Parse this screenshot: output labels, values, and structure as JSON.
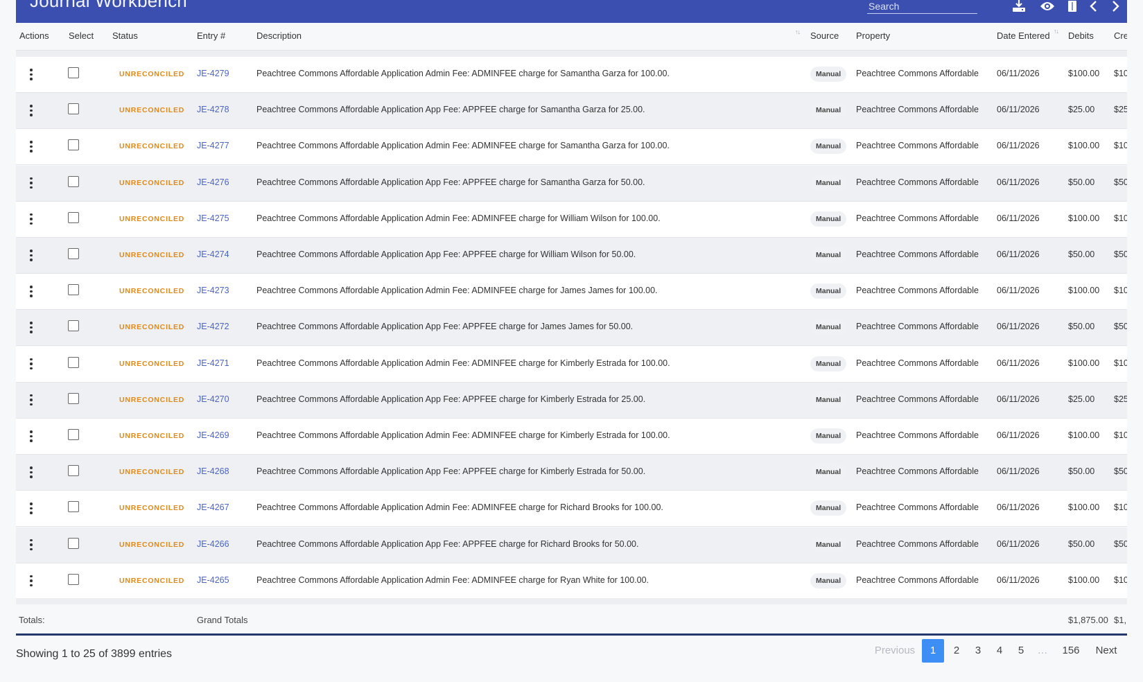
{
  "app": {
    "title": "Journal Workbench",
    "search_placeholder": "Search"
  },
  "toolbar": {
    "icons": [
      "download-icon",
      "eye-icon",
      "columns-icon",
      "chevron-left-icon",
      "chevron-right-icon"
    ]
  },
  "table": {
    "columns": {
      "actions": "Actions",
      "select": "Select",
      "status": "Status",
      "entry": "Entry #",
      "description": "Description",
      "source": "Source",
      "property": "Property",
      "date_entered": "Date Entered",
      "debits": "Debits",
      "credits": "Cre"
    },
    "rows": [
      {
        "status": "UNRECONCILED",
        "entry": "JE-4279",
        "description": "Peachtree Commons Affordable Application Admin Fee: ADMINFEE charge for Samantha Garza for 100.00.",
        "source": "Manual",
        "property": "Peachtree Commons Affordable",
        "date": "06/11/2026",
        "debit": "$100.00",
        "credit": "$10"
      },
      {
        "status": "UNRECONCILED",
        "entry": "JE-4278",
        "description": "Peachtree Commons Affordable Application App Fee: APPFEE charge for Samantha Garza for 25.00.",
        "source": "Manual",
        "property": "Peachtree Commons Affordable",
        "date": "06/11/2026",
        "debit": "$25.00",
        "credit": "$25"
      },
      {
        "status": "UNRECONCILED",
        "entry": "JE-4277",
        "description": "Peachtree Commons Affordable Application Admin Fee: ADMINFEE charge for Samantha Garza for 100.00.",
        "source": "Manual",
        "property": "Peachtree Commons Affordable",
        "date": "06/11/2026",
        "debit": "$100.00",
        "credit": "$10"
      },
      {
        "status": "UNRECONCILED",
        "entry": "JE-4276",
        "description": "Peachtree Commons Affordable Application App Fee: APPFEE charge for Samantha Garza for 50.00.",
        "source": "Manual",
        "property": "Peachtree Commons Affordable",
        "date": "06/11/2026",
        "debit": "$50.00",
        "credit": "$50"
      },
      {
        "status": "UNRECONCILED",
        "entry": "JE-4275",
        "description": "Peachtree Commons Affordable Application Admin Fee: ADMINFEE charge for William Wilson for 100.00.",
        "source": "Manual",
        "property": "Peachtree Commons Affordable",
        "date": "06/11/2026",
        "debit": "$100.00",
        "credit": "$10"
      },
      {
        "status": "UNRECONCILED",
        "entry": "JE-4274",
        "description": "Peachtree Commons Affordable Application App Fee: APPFEE charge for William Wilson for 50.00.",
        "source": "Manual",
        "property": "Peachtree Commons Affordable",
        "date": "06/11/2026",
        "debit": "$50.00",
        "credit": "$50"
      },
      {
        "status": "UNRECONCILED",
        "entry": "JE-4273",
        "description": "Peachtree Commons Affordable Application Admin Fee: ADMINFEE charge for James James for 100.00.",
        "source": "Manual",
        "property": "Peachtree Commons Affordable",
        "date": "06/11/2026",
        "debit": "$100.00",
        "credit": "$10"
      },
      {
        "status": "UNRECONCILED",
        "entry": "JE-4272",
        "description": "Peachtree Commons Affordable Application App Fee: APPFEE charge for James James for 50.00.",
        "source": "Manual",
        "property": "Peachtree Commons Affordable",
        "date": "06/11/2026",
        "debit": "$50.00",
        "credit": "$50"
      },
      {
        "status": "UNRECONCILED",
        "entry": "JE-4271",
        "description": "Peachtree Commons Affordable Application Admin Fee: ADMINFEE charge for Kimberly Estrada for 100.00.",
        "source": "Manual",
        "property": "Peachtree Commons Affordable",
        "date": "06/11/2026",
        "debit": "$100.00",
        "credit": "$10"
      },
      {
        "status": "UNRECONCILED",
        "entry": "JE-4270",
        "description": "Peachtree Commons Affordable Application App Fee: APPFEE charge for Kimberly Estrada for 25.00.",
        "source": "Manual",
        "property": "Peachtree Commons Affordable",
        "date": "06/11/2026",
        "debit": "$25.00",
        "credit": "$25"
      },
      {
        "status": "UNRECONCILED",
        "entry": "JE-4269",
        "description": "Peachtree Commons Affordable Application Admin Fee: ADMINFEE charge for Kimberly Estrada for 100.00.",
        "source": "Manual",
        "property": "Peachtree Commons Affordable",
        "date": "06/11/2026",
        "debit": "$100.00",
        "credit": "$10"
      },
      {
        "status": "UNRECONCILED",
        "entry": "JE-4268",
        "description": "Peachtree Commons Affordable Application App Fee: APPFEE charge for Kimberly Estrada for 50.00.",
        "source": "Manual",
        "property": "Peachtree Commons Affordable",
        "date": "06/11/2026",
        "debit": "$50.00",
        "credit": "$50"
      },
      {
        "status": "UNRECONCILED",
        "entry": "JE-4267",
        "description": "Peachtree Commons Affordable Application Admin Fee: ADMINFEE charge for Richard Brooks for 100.00.",
        "source": "Manual",
        "property": "Peachtree Commons Affordable",
        "date": "06/11/2026",
        "debit": "$100.00",
        "credit": "$10"
      },
      {
        "status": "UNRECONCILED",
        "entry": "JE-4266",
        "description": "Peachtree Commons Affordable Application App Fee: APPFEE charge for Richard Brooks for 50.00.",
        "source": "Manual",
        "property": "Peachtree Commons Affordable",
        "date": "06/11/2026",
        "debit": "$50.00",
        "credit": "$50"
      },
      {
        "status": "UNRECONCILED",
        "entry": "JE-4265",
        "description": "Peachtree Commons Affordable Application Admin Fee: ADMINFEE charge for Ryan White for 100.00.",
        "source": "Manual",
        "property": "Peachtree Commons Affordable",
        "date": "06/11/2026",
        "debit": "$100.00",
        "credit": "$10"
      }
    ],
    "totals": {
      "label": "Totals:",
      "grand_label": "Grand Totals",
      "debits": "$1,875.00",
      "credits": "$1,"
    }
  },
  "footer": {
    "showing": "Showing 1 to 25 of 3899 entries",
    "pagination": {
      "previous": "Previous",
      "pages": [
        "1",
        "2",
        "3",
        "4",
        "5",
        "…",
        "156"
      ],
      "current": "1",
      "next": "Next"
    }
  },
  "colors": {
    "header_bg": "#3a4fb0",
    "status_unreconciled": "#e08a1e",
    "link": "#4a63c8",
    "page_active": "#3d8ff5",
    "totals_border": "#24386e"
  }
}
